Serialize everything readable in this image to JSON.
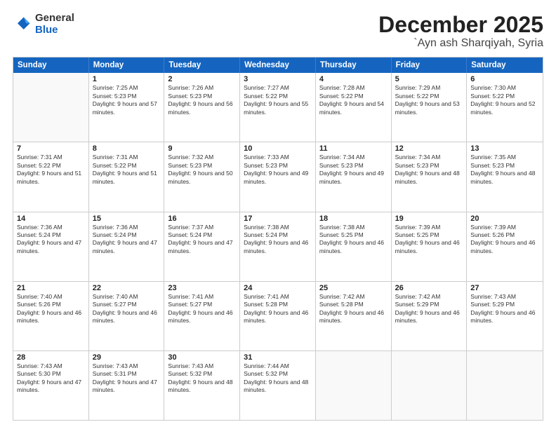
{
  "logo": {
    "general": "General",
    "blue": "Blue"
  },
  "title": {
    "month": "December 2025",
    "location": "`Ayn ash Sharqiyah, Syria"
  },
  "header": {
    "days": [
      "Sunday",
      "Monday",
      "Tuesday",
      "Wednesday",
      "Thursday",
      "Friday",
      "Saturday"
    ]
  },
  "rows": [
    [
      {
        "day": "",
        "sunrise": "",
        "sunset": "",
        "daylight": ""
      },
      {
        "day": "1",
        "sunrise": "Sunrise: 7:25 AM",
        "sunset": "Sunset: 5:23 PM",
        "daylight": "Daylight: 9 hours and 57 minutes."
      },
      {
        "day": "2",
        "sunrise": "Sunrise: 7:26 AM",
        "sunset": "Sunset: 5:23 PM",
        "daylight": "Daylight: 9 hours and 56 minutes."
      },
      {
        "day": "3",
        "sunrise": "Sunrise: 7:27 AM",
        "sunset": "Sunset: 5:22 PM",
        "daylight": "Daylight: 9 hours and 55 minutes."
      },
      {
        "day": "4",
        "sunrise": "Sunrise: 7:28 AM",
        "sunset": "Sunset: 5:22 PM",
        "daylight": "Daylight: 9 hours and 54 minutes."
      },
      {
        "day": "5",
        "sunrise": "Sunrise: 7:29 AM",
        "sunset": "Sunset: 5:22 PM",
        "daylight": "Daylight: 9 hours and 53 minutes."
      },
      {
        "day": "6",
        "sunrise": "Sunrise: 7:30 AM",
        "sunset": "Sunset: 5:22 PM",
        "daylight": "Daylight: 9 hours and 52 minutes."
      }
    ],
    [
      {
        "day": "7",
        "sunrise": "Sunrise: 7:31 AM",
        "sunset": "Sunset: 5:22 PM",
        "daylight": "Daylight: 9 hours and 51 minutes."
      },
      {
        "day": "8",
        "sunrise": "Sunrise: 7:31 AM",
        "sunset": "Sunset: 5:22 PM",
        "daylight": "Daylight: 9 hours and 51 minutes."
      },
      {
        "day": "9",
        "sunrise": "Sunrise: 7:32 AM",
        "sunset": "Sunset: 5:23 PM",
        "daylight": "Daylight: 9 hours and 50 minutes."
      },
      {
        "day": "10",
        "sunrise": "Sunrise: 7:33 AM",
        "sunset": "Sunset: 5:23 PM",
        "daylight": "Daylight: 9 hours and 49 minutes."
      },
      {
        "day": "11",
        "sunrise": "Sunrise: 7:34 AM",
        "sunset": "Sunset: 5:23 PM",
        "daylight": "Daylight: 9 hours and 49 minutes."
      },
      {
        "day": "12",
        "sunrise": "Sunrise: 7:34 AM",
        "sunset": "Sunset: 5:23 PM",
        "daylight": "Daylight: 9 hours and 48 minutes."
      },
      {
        "day": "13",
        "sunrise": "Sunrise: 7:35 AM",
        "sunset": "Sunset: 5:23 PM",
        "daylight": "Daylight: 9 hours and 48 minutes."
      }
    ],
    [
      {
        "day": "14",
        "sunrise": "Sunrise: 7:36 AM",
        "sunset": "Sunset: 5:24 PM",
        "daylight": "Daylight: 9 hours and 47 minutes."
      },
      {
        "day": "15",
        "sunrise": "Sunrise: 7:36 AM",
        "sunset": "Sunset: 5:24 PM",
        "daylight": "Daylight: 9 hours and 47 minutes."
      },
      {
        "day": "16",
        "sunrise": "Sunrise: 7:37 AM",
        "sunset": "Sunset: 5:24 PM",
        "daylight": "Daylight: 9 hours and 47 minutes."
      },
      {
        "day": "17",
        "sunrise": "Sunrise: 7:38 AM",
        "sunset": "Sunset: 5:24 PM",
        "daylight": "Daylight: 9 hours and 46 minutes."
      },
      {
        "day": "18",
        "sunrise": "Sunrise: 7:38 AM",
        "sunset": "Sunset: 5:25 PM",
        "daylight": "Daylight: 9 hours and 46 minutes."
      },
      {
        "day": "19",
        "sunrise": "Sunrise: 7:39 AM",
        "sunset": "Sunset: 5:25 PM",
        "daylight": "Daylight: 9 hours and 46 minutes."
      },
      {
        "day": "20",
        "sunrise": "Sunrise: 7:39 AM",
        "sunset": "Sunset: 5:26 PM",
        "daylight": "Daylight: 9 hours and 46 minutes."
      }
    ],
    [
      {
        "day": "21",
        "sunrise": "Sunrise: 7:40 AM",
        "sunset": "Sunset: 5:26 PM",
        "daylight": "Daylight: 9 hours and 46 minutes."
      },
      {
        "day": "22",
        "sunrise": "Sunrise: 7:40 AM",
        "sunset": "Sunset: 5:27 PM",
        "daylight": "Daylight: 9 hours and 46 minutes."
      },
      {
        "day": "23",
        "sunrise": "Sunrise: 7:41 AM",
        "sunset": "Sunset: 5:27 PM",
        "daylight": "Daylight: 9 hours and 46 minutes."
      },
      {
        "day": "24",
        "sunrise": "Sunrise: 7:41 AM",
        "sunset": "Sunset: 5:28 PM",
        "daylight": "Daylight: 9 hours and 46 minutes."
      },
      {
        "day": "25",
        "sunrise": "Sunrise: 7:42 AM",
        "sunset": "Sunset: 5:28 PM",
        "daylight": "Daylight: 9 hours and 46 minutes."
      },
      {
        "day": "26",
        "sunrise": "Sunrise: 7:42 AM",
        "sunset": "Sunset: 5:29 PM",
        "daylight": "Daylight: 9 hours and 46 minutes."
      },
      {
        "day": "27",
        "sunrise": "Sunrise: 7:43 AM",
        "sunset": "Sunset: 5:29 PM",
        "daylight": "Daylight: 9 hours and 46 minutes."
      }
    ],
    [
      {
        "day": "28",
        "sunrise": "Sunrise: 7:43 AM",
        "sunset": "Sunset: 5:30 PM",
        "daylight": "Daylight: 9 hours and 47 minutes."
      },
      {
        "day": "29",
        "sunrise": "Sunrise: 7:43 AM",
        "sunset": "Sunset: 5:31 PM",
        "daylight": "Daylight: 9 hours and 47 minutes."
      },
      {
        "day": "30",
        "sunrise": "Sunrise: 7:43 AM",
        "sunset": "Sunset: 5:32 PM",
        "daylight": "Daylight: 9 hours and 48 minutes."
      },
      {
        "day": "31",
        "sunrise": "Sunrise: 7:44 AM",
        "sunset": "Sunset: 5:32 PM",
        "daylight": "Daylight: 9 hours and 48 minutes."
      },
      {
        "day": "",
        "sunrise": "",
        "sunset": "",
        "daylight": ""
      },
      {
        "day": "",
        "sunrise": "",
        "sunset": "",
        "daylight": ""
      },
      {
        "day": "",
        "sunrise": "",
        "sunset": "",
        "daylight": ""
      }
    ]
  ]
}
